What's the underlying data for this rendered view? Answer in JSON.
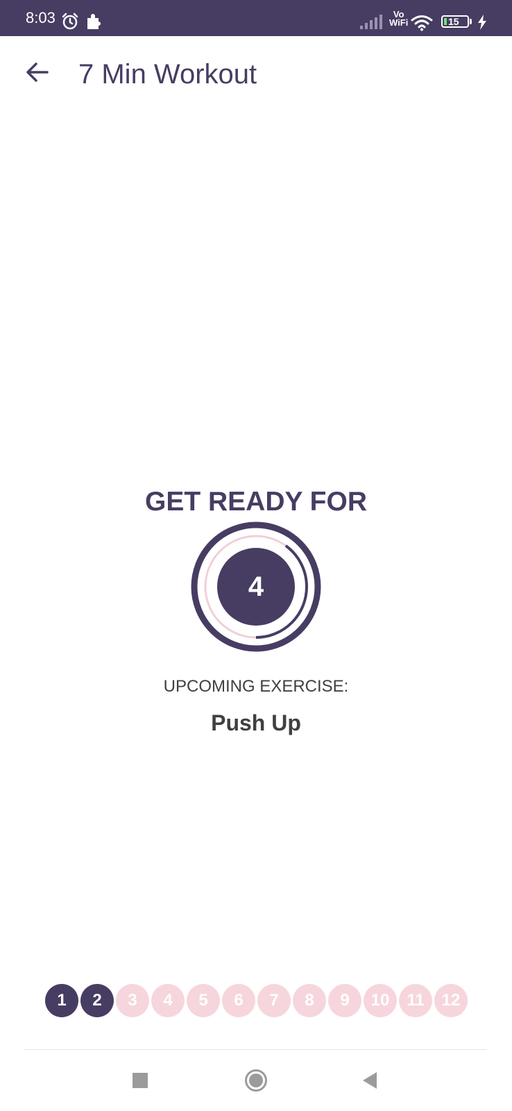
{
  "status_bar": {
    "time": "8:03",
    "network_label_top": "Vo",
    "network_label_bottom": "WiFi",
    "battery_level": "15",
    "background_color": "#473d63",
    "icons": [
      "alarm-icon",
      "puzzle-icon",
      "signal-icon",
      "wifi-icon",
      "battery-icon",
      "charging-icon"
    ]
  },
  "app_bar": {
    "back_icon": "arrow-left-icon",
    "title": "7 Min Workout"
  },
  "main": {
    "heading": "GET READY FOR",
    "timer_value": "4",
    "timer_progress": 0.4,
    "upcoming_label": "UPCOMING EXERCISE:",
    "exercise_name": "Push Up"
  },
  "progress_steps": {
    "items": [
      "1",
      "2",
      "3",
      "4",
      "5",
      "6",
      "7",
      "8",
      "9",
      "10",
      "11",
      "12"
    ],
    "completed_count": 2
  },
  "nav_bar": {
    "icons": [
      "recents-square-icon",
      "home-circle-icon",
      "back-triangle-icon"
    ]
  },
  "colors": {
    "primary": "#473d63",
    "step_pending": "#f6d6dc",
    "text_dark": "#404040",
    "timer_track": "#f2cfd6"
  }
}
